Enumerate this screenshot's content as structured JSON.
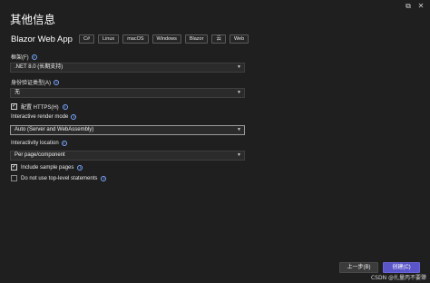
{
  "window": {
    "title": "其他信息",
    "close_glyph": "✕",
    "restore_glyph": "⧉"
  },
  "template": {
    "name": "Blazor Web App",
    "tags": [
      "C#",
      "Linux",
      "macOS",
      "Windows",
      "Blazor",
      "云",
      "Web"
    ]
  },
  "form": {
    "framework": {
      "label": "框架(F)",
      "value": ".NET 8.0 (长期支持)"
    },
    "auth": {
      "label": "身份验证类型(A)",
      "value": "无"
    },
    "https": {
      "label": "配置 HTTPS(H)",
      "checked": true
    },
    "render_mode": {
      "label": "Interactive render mode",
      "value": "Auto (Server and WebAssembly)"
    },
    "interactivity_location": {
      "label": "Interactivity location",
      "value": "Per page/component"
    },
    "sample_pages": {
      "label": "Include sample pages",
      "checked": true
    },
    "top_level_statements": {
      "label": "Do not use top-level statements",
      "checked": false
    }
  },
  "footer": {
    "back_label": "上一步(B)",
    "create_label": "创建(C)"
  },
  "watermark": "CSDN @扎量丙不要犟",
  "glyphs": {
    "info": "i",
    "caret": "▼",
    "check": "✓"
  },
  "colors": {
    "accent": "#5a55c9",
    "info": "#7aa7ff",
    "background": "#1f1f1f"
  }
}
